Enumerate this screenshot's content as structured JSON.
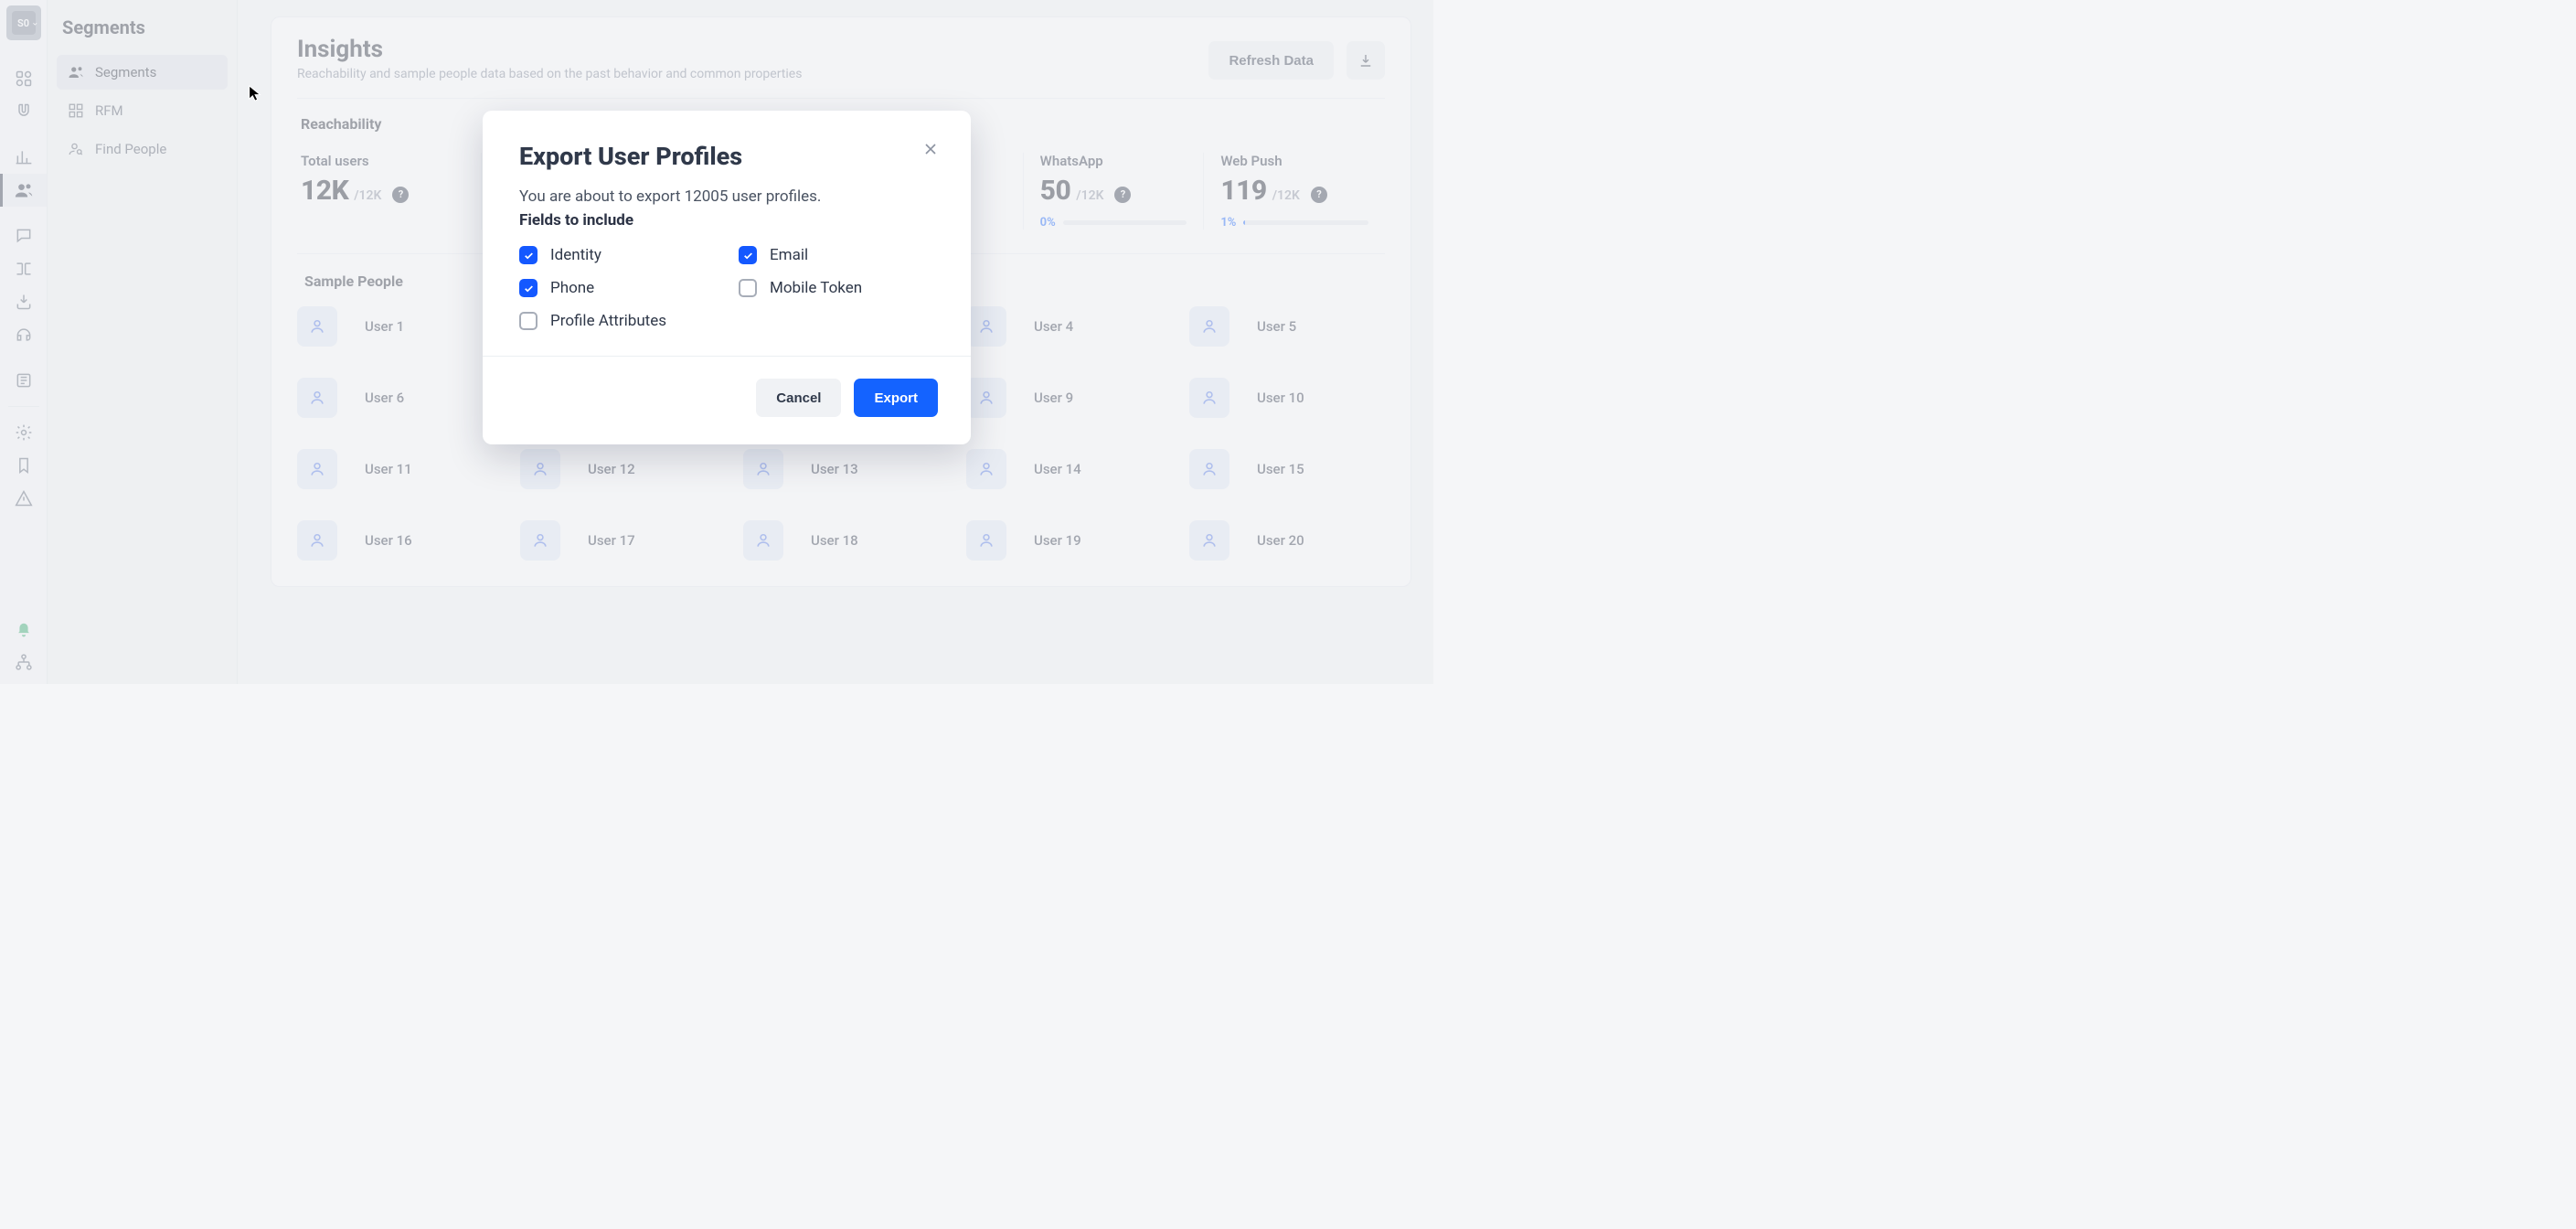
{
  "org_badge": "S0",
  "sidebar": {
    "title": "Segments",
    "items": [
      {
        "label": "Segments",
        "active": true
      },
      {
        "label": "RFM",
        "active": false
      },
      {
        "label": "Find People",
        "active": false
      }
    ]
  },
  "insights": {
    "title": "Insights",
    "subtitle": "Reachability and sample people data based on the past behavior and common properties",
    "refresh_label": "Refresh Data"
  },
  "reachability": {
    "title": "Reachability",
    "cells": [
      {
        "label": "Total users",
        "value": "12K",
        "denom": "/12K",
        "pct": "",
        "fill": 0
      },
      {
        "label": "",
        "value": "",
        "denom": "",
        "pct": "",
        "fill": 0
      },
      {
        "label": "",
        "value": "",
        "denom": "",
        "pct": "",
        "fill": 0
      },
      {
        "label": "",
        "value": "",
        "denom": "",
        "pct": "",
        "fill": 0
      },
      {
        "label": "WhatsApp",
        "value": "50",
        "denom": "/12K",
        "pct": "0%",
        "fill": 0
      },
      {
        "label": "Web Push",
        "value": "119",
        "denom": "/12K",
        "pct": "1%",
        "fill": 1
      }
    ]
  },
  "sample": {
    "title": "Sample People",
    "people": [
      "User 1",
      "User 4",
      "User 5",
      "User 6",
      "User 9",
      "User 10",
      "User 11",
      "User 12",
      "User 13",
      "User 14",
      "User 15",
      "User 16",
      "User 17",
      "User 18",
      "User 19",
      "User 20"
    ],
    "grid_positions": [
      [
        0,
        0
      ],
      [
        0,
        3
      ],
      [
        0,
        4
      ],
      [
        1,
        0
      ],
      [
        1,
        3
      ],
      [
        1,
        4
      ],
      [
        2,
        0
      ],
      [
        2,
        1
      ],
      [
        2,
        2
      ],
      [
        2,
        3
      ],
      [
        2,
        4
      ],
      [
        3,
        0
      ],
      [
        3,
        1
      ],
      [
        3,
        2
      ],
      [
        3,
        3
      ],
      [
        3,
        4
      ]
    ]
  },
  "modal": {
    "title": "Export User Profiles",
    "line": "You are about to export 12005 user profiles.",
    "subhead": "Fields to include",
    "fields": [
      {
        "label": "Identity",
        "checked": true
      },
      {
        "label": "Email",
        "checked": true
      },
      {
        "label": "Phone",
        "checked": true
      },
      {
        "label": "Mobile Token",
        "checked": false
      },
      {
        "label": "Profile Attributes",
        "checked": false
      }
    ],
    "cancel": "Cancel",
    "export": "Export"
  }
}
